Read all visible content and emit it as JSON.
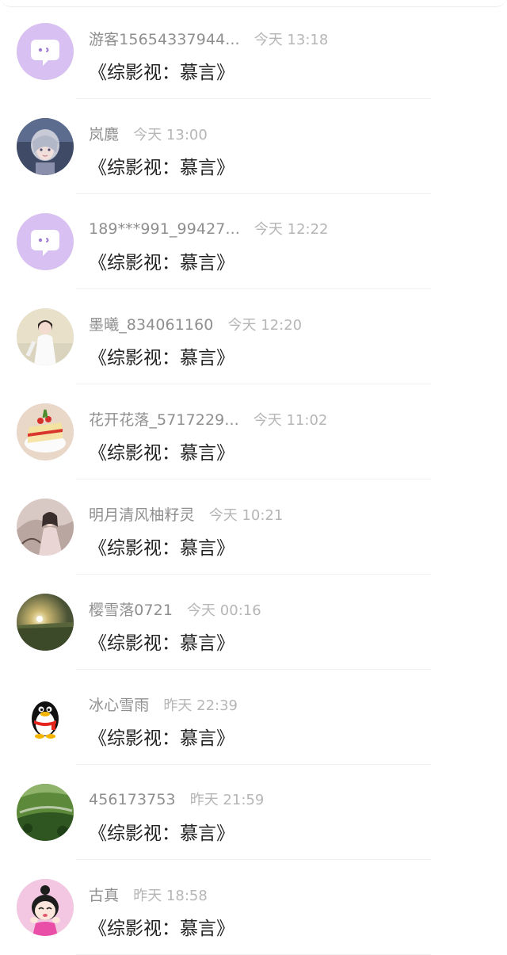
{
  "items": [
    {
      "avatar": "chat-bubble-icon",
      "username": "游客15654337944...",
      "time": "今天 13:18",
      "message": "《综影视：慕言》"
    },
    {
      "avatar": "anime-girl-avatar",
      "username": "岚麑",
      "time": "今天 13:00",
      "message": "《综影视：慕言》"
    },
    {
      "avatar": "chat-bubble-icon",
      "username": "189***991_99427...",
      "time": "今天 12:22",
      "message": "《综影视：慕言》"
    },
    {
      "avatar": "woman-white-dress-avatar",
      "username": "墨曦_834061160",
      "time": "今天 12:20",
      "message": "《综影视：慕言》"
    },
    {
      "avatar": "dessert-avatar",
      "username": "花开花落_5717229...",
      "time": "今天 11:02",
      "message": "《综影视：慕言》"
    },
    {
      "avatar": "ancient-costume-avatar",
      "username": "明月清风柚籽灵",
      "time": "今天 10:21",
      "message": "《综影视：慕言》"
    },
    {
      "avatar": "sunset-field-avatar",
      "username": "樱雪落0721",
      "time": "今天 00:16",
      "message": "《综影视：慕言》"
    },
    {
      "avatar": "penguin-icon",
      "username": "冰心雪雨",
      "time": "昨天 22:39",
      "message": "《综影视：慕言》"
    },
    {
      "avatar": "green-hills-avatar",
      "username": "456173753",
      "time": "昨天 21:59",
      "message": "《综影视：慕言》"
    },
    {
      "avatar": "cartoon-girl-avatar",
      "username": "古真",
      "time": "昨天 18:58",
      "message": "《综影视：慕言》"
    }
  ],
  "colors": {
    "username": "#8f8f8f",
    "time": "#b6b6b6",
    "message": "#222222",
    "default_avatar_bg": "#d8c1f2"
  }
}
